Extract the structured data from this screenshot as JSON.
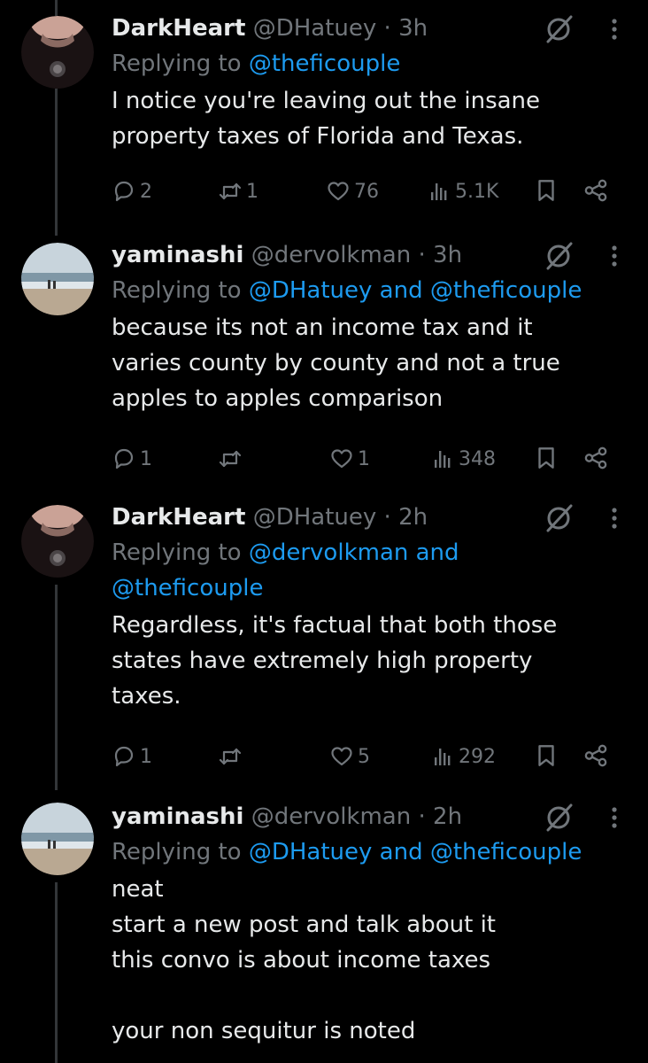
{
  "tweets": [
    {
      "name": "DarkHeart",
      "handle": "@DHatuey",
      "time": "3h",
      "replying_prefix": "Replying to",
      "replying_to": "@theficouple",
      "text": "I notice you're leaving out the insane\nproperty taxes of Florida and Texas.",
      "replies": "2",
      "reposts": "1",
      "likes": "76",
      "views": "5.1K"
    },
    {
      "name": "yaminashi",
      "handle": "@dervolkman",
      "time": "3h",
      "replying_prefix": "Replying to",
      "replying_to": "@DHatuey and @theficouple",
      "text": "because its not an income tax and it\nvaries county by county and not a true\napples to apples comparison",
      "replies": "1",
      "reposts": "",
      "likes": "1",
      "views": "348"
    },
    {
      "name": "DarkHeart",
      "handle": "@DHatuey",
      "time": "2h",
      "replying_prefix": "Replying to",
      "replying_to": "@dervolkman and\n@theficouple",
      "text": "Regardless, it's factual that both those\nstates have extremely high property\ntaxes.",
      "replies": "1",
      "reposts": "",
      "likes": "5",
      "views": "292"
    },
    {
      "name": "yaminashi",
      "handle": "@dervolkman",
      "time": "2h",
      "replying_prefix": "Replying to",
      "replying_to": "@DHatuey and @theficouple",
      "text": "neat\nstart a new post and talk about it\nthis convo is about income taxes\n\nyour non sequitur is noted",
      "replies": "",
      "reposts": "",
      "likes": "",
      "views": ""
    }
  ],
  "separator": "·",
  "icons": {
    "reply": "reply-icon",
    "repost": "repost-icon",
    "like": "heart-icon",
    "views": "views-icon",
    "bookmark": "bookmark-icon",
    "share": "share-icon",
    "grok": "grok-icon",
    "more": "more-icon"
  },
  "colors": {
    "background": "#000000",
    "text": "#e7e9ea",
    "muted": "#71767b",
    "link": "#1d9bf0"
  }
}
